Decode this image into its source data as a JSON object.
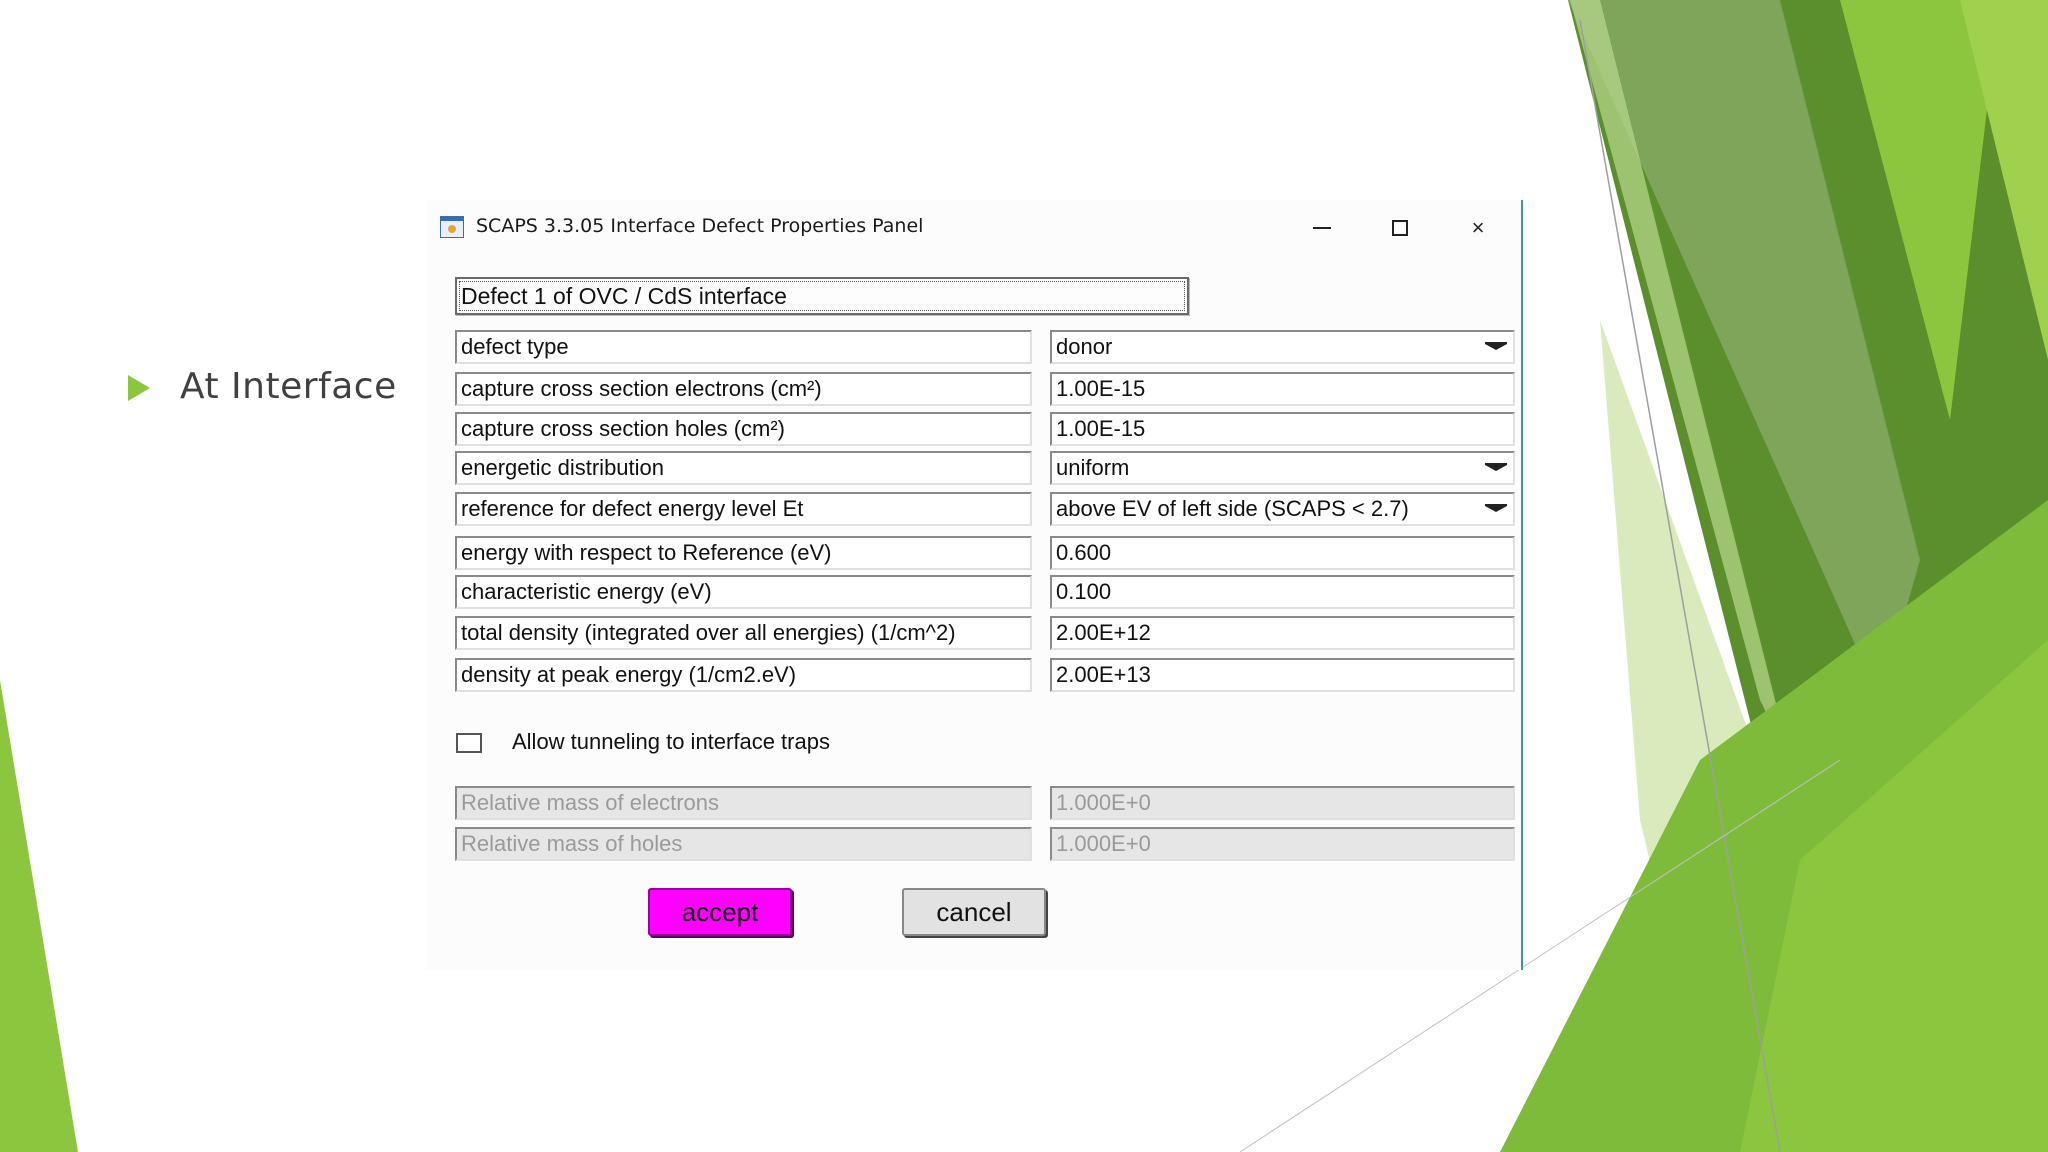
{
  "slide": {
    "bullet": "At Interface",
    "colors": {
      "accent": "#8cc63f",
      "dark_green": "#5a8f2c"
    }
  },
  "window": {
    "title": "SCAPS 3.3.05 Interface Defect Properties Panel",
    "icon": "app-icon",
    "controls": {
      "minimize": "minimize-icon",
      "maximize": "maximize-icon",
      "close": "×"
    }
  },
  "panel": {
    "defect_title": "Defect 1 of OVC / CdS interface",
    "rows": [
      {
        "label": "defect type",
        "value": "donor",
        "dropdown": true
      },
      {
        "label": "capture cross section electrons (cm²)",
        "value": "1.00E-15"
      },
      {
        "label": "capture cross section holes (cm²)",
        "value": "1.00E-15"
      },
      {
        "label": "energetic distribution",
        "value": "uniform",
        "dropdown": true
      },
      {
        "label": "reference for defect energy level Et",
        "value": "above EV of left side (SCAPS < 2.7)",
        "dropdown": true
      },
      {
        "label": "energy with respect to Reference (eV)",
        "value": "0.600"
      },
      {
        "label": "characteristic energy (eV)",
        "value": "0.100"
      },
      {
        "label": "total  density (integrated over all energies) (1/cm^2)",
        "value": "2.00E+12"
      },
      {
        "label": "density at peak energy (1/cm2.eV)",
        "value": "2.00E+13"
      }
    ],
    "tunneling": {
      "label": "Allow tunneling to interface traps",
      "checked": false
    },
    "mass_rows": [
      {
        "label": "Relative mass of electrons",
        "value": "1.000E+0"
      },
      {
        "label": "Relative mass of holes",
        "value": "1.000E+0"
      }
    ],
    "buttons": {
      "accept": "accept",
      "cancel": "cancel"
    },
    "colors": {
      "accept_bg": "#ff00ff",
      "cancel_bg": "#e2e2e2",
      "window_border": "#3c8ed1"
    }
  }
}
